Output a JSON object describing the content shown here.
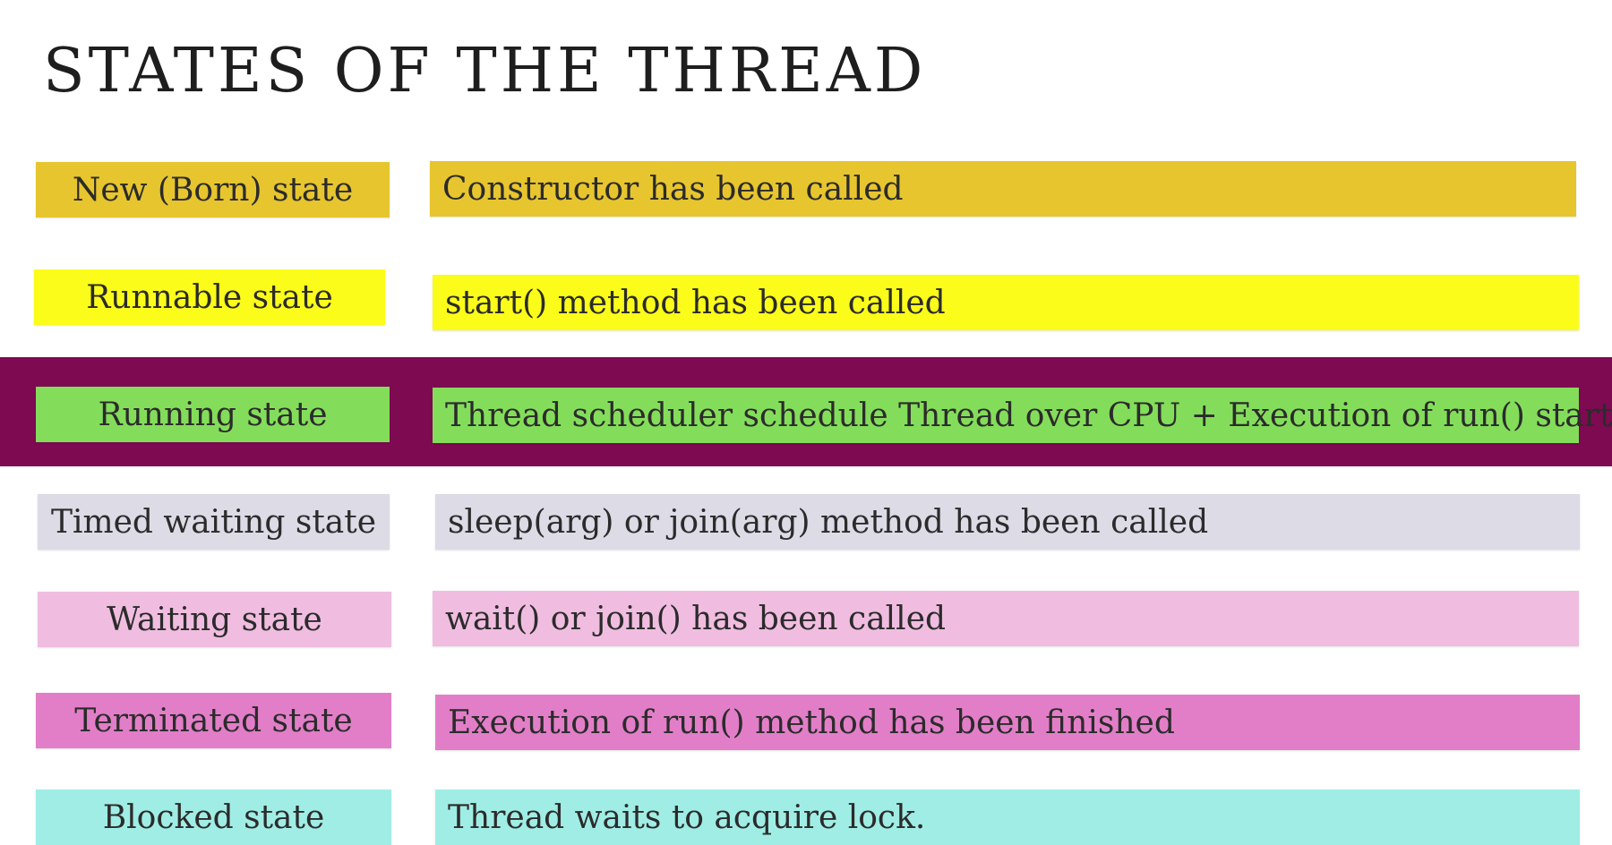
{
  "title": "STATES OF THE THREAD",
  "states": [
    {
      "state": "New (Born) state",
      "description": "Constructor has been called",
      "color": "#e7c52e"
    },
    {
      "state": "Runnable state",
      "description": "start() method has been called",
      "color": "#fbfc1a"
    },
    {
      "state": "Running state",
      "description": "Thread scheduler schedule Thread over CPU + Execution of run() starts",
      "color": "#84dd5a",
      "highlighted": true
    },
    {
      "state": "Timed waiting state",
      "description": "sleep(arg) or join(arg) method has been called",
      "color": "#dcdbe6"
    },
    {
      "state": "Waiting state",
      "description": "wait() or join() has been called",
      "color": "#f0bde0"
    },
    {
      "state": "Terminated state",
      "description": "Execution of run() method has been finished",
      "color": "#e27ec8"
    },
    {
      "state": "Blocked state",
      "description": "Thread waits to acquire lock.",
      "color": "#a0ede5"
    }
  ],
  "highlight_color": "#7e0a52"
}
